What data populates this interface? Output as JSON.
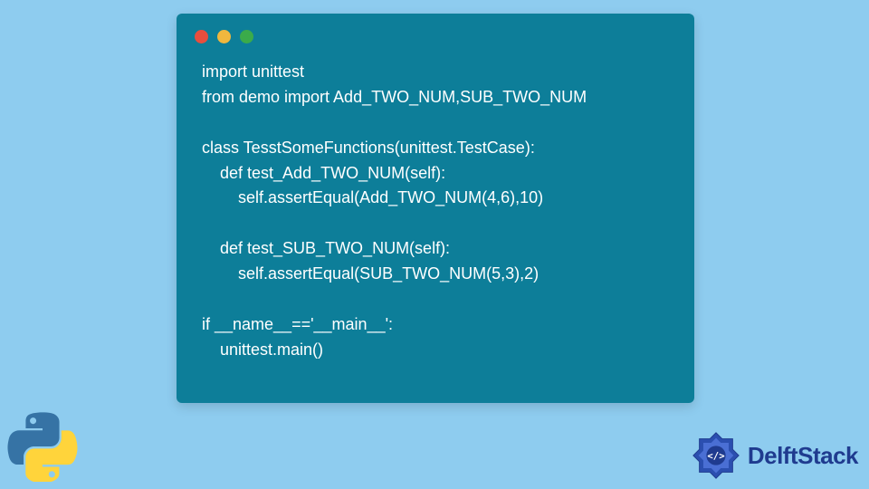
{
  "code": {
    "line1": "import unittest",
    "line2": "from demo import Add_TWO_NUM,SUB_TWO_NUM",
    "line3": "",
    "line4": "class TesstSomeFunctions(unittest.TestCase):",
    "line5": "    def test_Add_TWO_NUM(self):",
    "line6": "        self.assertEqual(Add_TWO_NUM(4,6),10)",
    "line7": "",
    "line8": "    def test_SUB_TWO_NUM(self):",
    "line9": "        self.assertEqual(SUB_TWO_NUM(5,3),2)",
    "line10": "",
    "line11": "if __name__=='__main__':",
    "line12": "    unittest.main()"
  },
  "branding": {
    "site_name": "DelftStack"
  },
  "colors": {
    "background": "#8ECCEF",
    "window": "#0D7E99",
    "text": "#FFFFFF",
    "dot_red": "#E84E3E",
    "dot_yellow": "#F0B73E",
    "dot_green": "#3BAB4A",
    "delft_blue": "#1F3B8F"
  }
}
